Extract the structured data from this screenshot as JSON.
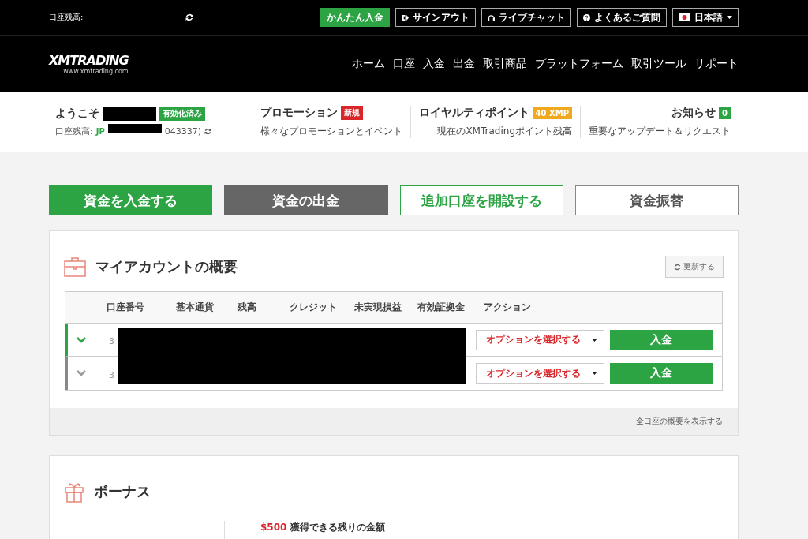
{
  "top_bar": {
    "balance_label": "口座残高:",
    "buttons": [
      {
        "label": "かんたん入金",
        "kind": "primary"
      },
      {
        "label": "サインアウト",
        "kind": "signout"
      },
      {
        "label": "ライブチャット",
        "kind": "chat"
      },
      {
        "label": "よくあるご質問",
        "kind": "faq"
      }
    ],
    "language": "日本語"
  },
  "header": {
    "logo": "XMTRADING",
    "logo_sub": "www.xmtrading.com",
    "nav": [
      "ホーム",
      "口座",
      "入金",
      "出金",
      "取引商品",
      "プラットフォーム",
      "取引ツール",
      "サポート"
    ]
  },
  "welcome": {
    "greeting": "ようこそ",
    "status_badge": "有効化済み",
    "balance_label": "口座残高:",
    "account_prefix": "JP",
    "account_suffix": "043337)"
  },
  "info_items": [
    {
      "title": "プロモーション",
      "badge": "新規",
      "color": "#d9262b",
      "subtitle": "様々なプロモーションとイベント"
    },
    {
      "title": "ロイヤルティポイント",
      "badge": "40 XMP",
      "color": "#f0a81e",
      "subtitle": "現在のXMTradingポイント残高"
    },
    {
      "title": "お知らせ",
      "badge": "0",
      "color": "#2ca444",
      "subtitle": "重要なアップデート＆リクエスト"
    }
  ],
  "actions": [
    {
      "label": "資金を入金する",
      "kind": "green"
    },
    {
      "label": "資金の出金",
      "kind": "grey"
    },
    {
      "label": "追加口座を開設する",
      "kind": "outline-green"
    },
    {
      "label": "資金振替",
      "kind": "outline-grey"
    }
  ],
  "accounts": {
    "title": "マイアカウントの概要",
    "refresh": "更新する",
    "columns": [
      "口座番号",
      "基本通貨",
      "残高",
      "クレジット",
      "未実現損益",
      "有効証拠金",
      "アクション"
    ],
    "rows": [
      {
        "account_start": "3",
        "selected": true,
        "option": "オプションを選択する",
        "deposit": "入金"
      },
      {
        "account_start": "3",
        "selected": false,
        "option": "オプションを選択する",
        "deposit": "入金"
      }
    ],
    "footer_link": "全口座の概要を表示する"
  },
  "bonus": {
    "title": "ボーナス",
    "amount": "$500",
    "amount_label": "獲得できる残りの金額"
  }
}
